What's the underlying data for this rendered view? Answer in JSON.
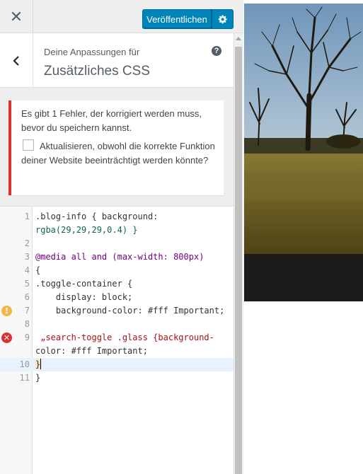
{
  "topbar": {
    "close_icon": "close-icon",
    "publish_label": "Veröffentlichen",
    "settings_icon": "gear-icon",
    "accent": "#0085ba"
  },
  "section": {
    "back_icon": "chevron-left-icon",
    "subtitle": "Deine Anpassungen für",
    "title": "Zusätzliches CSS",
    "help_icon": "help-icon",
    "help_glyph": "?"
  },
  "notice": {
    "message": "Es gibt 1 Fehler, der korrigiert werden muss, bevor du speichern kannst.",
    "checkbox_label": "Aktualisieren, obwohl die korrekte Funktion deiner Website beeinträchtigt werden könnte?",
    "checked": false,
    "border_color": "#dc3232"
  },
  "editor": {
    "lines": [
      {
        "no": "1",
        "text": ".blog-info { background:"
      },
      {
        "no": "",
        "text": "rgba(29,29,29,0.4) }"
      },
      {
        "no": "2",
        "text": ""
      },
      {
        "no": "3",
        "text": "@media all and (max-width: 800px)"
      },
      {
        "no": "4",
        "text": "{"
      },
      {
        "no": "5",
        "text": ".toggle-container {"
      },
      {
        "no": "6",
        "text": "    display: block;"
      },
      {
        "no": "7",
        "text": "    background-color: #fff Important;"
      },
      {
        "no": "8",
        "text": ""
      },
      {
        "no": "9",
        "text": " „search-toggle .glass {background-"
      },
      {
        "no": "",
        "text": "color: #fff Important;"
      },
      {
        "no": "10",
        "text": "}"
      },
      {
        "no": "11",
        "text": "}"
      }
    ],
    "warning_line": "7",
    "error_line": "9",
    "warning_color": "#f0b849",
    "error_color": "#dc3232",
    "active_line": "10"
  },
  "preview": {
    "image": "tree-landscape-photo",
    "sky_color": "#5a82a8",
    "ground_color": "#6b5a22",
    "band_color": "#1b1b1b"
  }
}
